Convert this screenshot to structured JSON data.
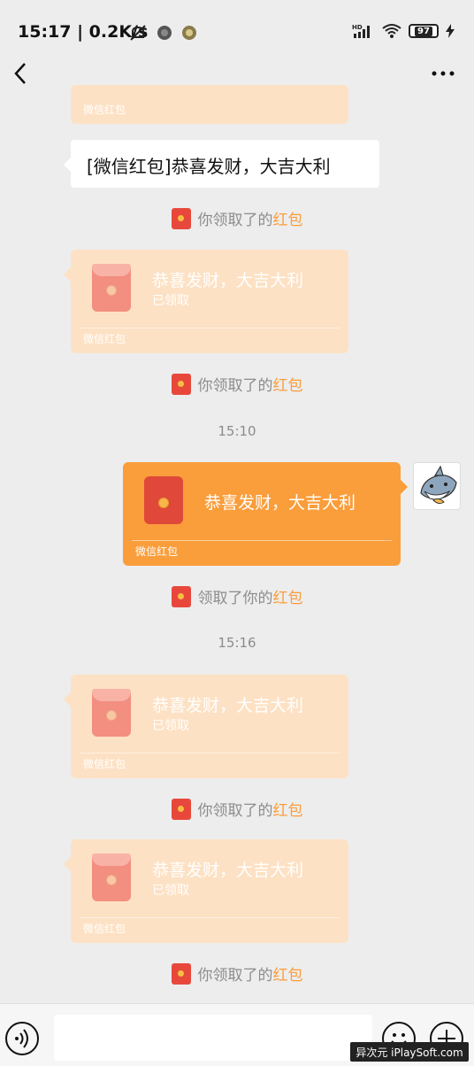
{
  "status_bar": {
    "time": "15:17",
    "network_speed": "0.2K/s",
    "battery": "97"
  },
  "messages": {
    "top_partial_footer": "微信红包",
    "text_message": "[微信红包]恭喜发财，大吉大利",
    "system_1_prefix": "你领取了的",
    "system_1_highlight": "红包",
    "packet_1": {
      "title": "恭喜发财，大吉大利",
      "status": "已领取",
      "footer": "微信红包"
    },
    "system_2_prefix": "你领取了的",
    "system_2_highlight": "红包",
    "timestamp_1": "15:10",
    "packet_2": {
      "title": "恭喜发财，大吉大利",
      "footer": "微信红包"
    },
    "system_3_prefix": "领取了你的",
    "system_3_highlight": "红包",
    "timestamp_2": "15:16",
    "packet_3": {
      "title": "恭喜发财，大吉大利",
      "status": "已领取",
      "footer": "微信红包"
    },
    "system_4_prefix": "你领取了的",
    "system_4_highlight": "红包",
    "packet_4": {
      "title": "恭喜发财，大吉大利",
      "status": "已领取",
      "footer": "微信红包"
    },
    "system_5_prefix": "你领取了的",
    "system_5_highlight": "红包"
  },
  "watermark": "异次元 iPlaySoft.com",
  "colors": {
    "accent": "#fa9d3b",
    "received_packet": "#fde1c4",
    "background": "#ededed"
  }
}
